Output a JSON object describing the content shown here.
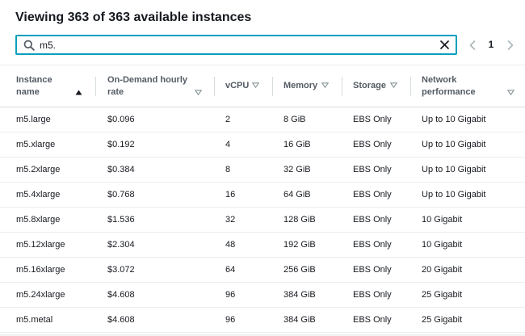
{
  "header": {
    "title": "Viewing 363 of 363 available instances"
  },
  "search": {
    "value": "m5.",
    "icon": "search-icon",
    "clear_icon": "close-icon"
  },
  "pagination": {
    "current_page": "1",
    "prev_icon": "chevron-left-icon",
    "next_icon": "chevron-right-icon"
  },
  "colors": {
    "accent": "#0a9fbd",
    "text": "#16191f",
    "header_text": "#545b64",
    "divider": "#eaeded"
  },
  "table": {
    "columns": [
      {
        "key": "name",
        "line1": "Instance",
        "line2": "name",
        "sort": "ascending"
      },
      {
        "key": "rate",
        "line1": "On-Demand hourly",
        "line2": "rate",
        "sort": "none"
      },
      {
        "key": "vcpu",
        "line1": "vCPU",
        "line2": "",
        "sort": "none"
      },
      {
        "key": "memory",
        "line1": "Memory",
        "line2": "",
        "sort": "none"
      },
      {
        "key": "storage",
        "line1": "Storage",
        "line2": "",
        "sort": "none"
      },
      {
        "key": "network",
        "line1": "Network",
        "line2": "performance",
        "sort": "none"
      }
    ],
    "rows": [
      {
        "name": "m5.large",
        "rate": "$0.096",
        "vcpu": "2",
        "memory": "8 GiB",
        "storage": "EBS Only",
        "network": "Up to 10 Gigabit"
      },
      {
        "name": "m5.xlarge",
        "rate": "$0.192",
        "vcpu": "4",
        "memory": "16 GiB",
        "storage": "EBS Only",
        "network": "Up to 10 Gigabit"
      },
      {
        "name": "m5.2xlarge",
        "rate": "$0.384",
        "vcpu": "8",
        "memory": "32 GiB",
        "storage": "EBS Only",
        "network": "Up to 10 Gigabit"
      },
      {
        "name": "m5.4xlarge",
        "rate": "$0.768",
        "vcpu": "16",
        "memory": "64 GiB",
        "storage": "EBS Only",
        "network": "Up to 10 Gigabit"
      },
      {
        "name": "m5.8xlarge",
        "rate": "$1.536",
        "vcpu": "32",
        "memory": "128 GiB",
        "storage": "EBS Only",
        "network": "10 Gigabit"
      },
      {
        "name": "m5.12xlarge",
        "rate": "$2.304",
        "vcpu": "48",
        "memory": "192 GiB",
        "storage": "EBS Only",
        "network": "10 Gigabit"
      },
      {
        "name": "m5.16xlarge",
        "rate": "$3.072",
        "vcpu": "64",
        "memory": "256 GiB",
        "storage": "EBS Only",
        "network": "20 Gigabit"
      },
      {
        "name": "m5.24xlarge",
        "rate": "$4.608",
        "vcpu": "96",
        "memory": "384 GiB",
        "storage": "EBS Only",
        "network": "25 Gigabit"
      },
      {
        "name": "m5.metal",
        "rate": "$4.608",
        "vcpu": "96",
        "memory": "384 GiB",
        "storage": "EBS Only",
        "network": "25 Gigabit"
      }
    ]
  }
}
